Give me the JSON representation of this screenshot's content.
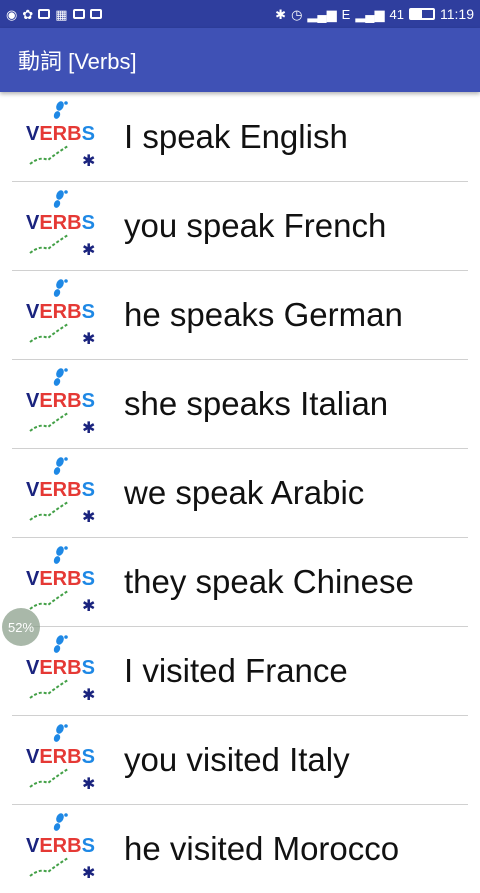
{
  "status_bar": {
    "network_label": "E",
    "signal_level": "41",
    "time": "11:19",
    "battery_fraction": 0.5
  },
  "app_bar": {
    "title": "動詞 [Verbs]"
  },
  "logo": {
    "text": "VERBS"
  },
  "verbs": [
    {
      "phrase": "I speak English"
    },
    {
      "phrase": "you speak French"
    },
    {
      "phrase": "he speaks German"
    },
    {
      "phrase": "she speaks Italian"
    },
    {
      "phrase": "we speak Arabic"
    },
    {
      "phrase": "they speak Chinese"
    },
    {
      "phrase": "I visited France"
    },
    {
      "phrase": "you visited Italy"
    },
    {
      "phrase": "he visited Morocco"
    }
  ],
  "progress_badge": {
    "label": "52%"
  },
  "colors": {
    "status_bar": "#2f3e9e",
    "app_bar": "#3f51b5",
    "logo_v": "#1a237e",
    "logo_erb": "#e53935",
    "logo_s": "#1e88e5",
    "logo_swoosh": "#43a047"
  }
}
